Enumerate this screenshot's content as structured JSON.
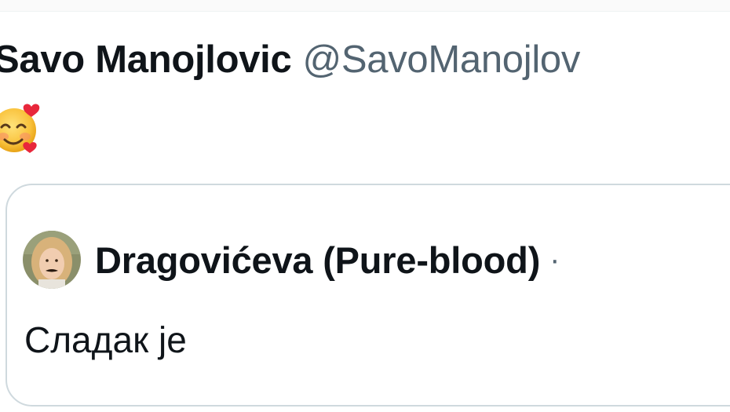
{
  "tweet": {
    "author_name": "Savo Manojlovic",
    "author_handle": "@SavoManojlov",
    "text_emoji": "smiling-face-with-hearts"
  },
  "quoted_tweet": {
    "author_name": "Dragovićeva (Pure-blood)",
    "separator": "·",
    "text": "Сладак је"
  },
  "colors": {
    "text_primary": "#0f1419",
    "text_secondary": "#536471",
    "border": "#cfd9de",
    "background": "#ffffff"
  }
}
